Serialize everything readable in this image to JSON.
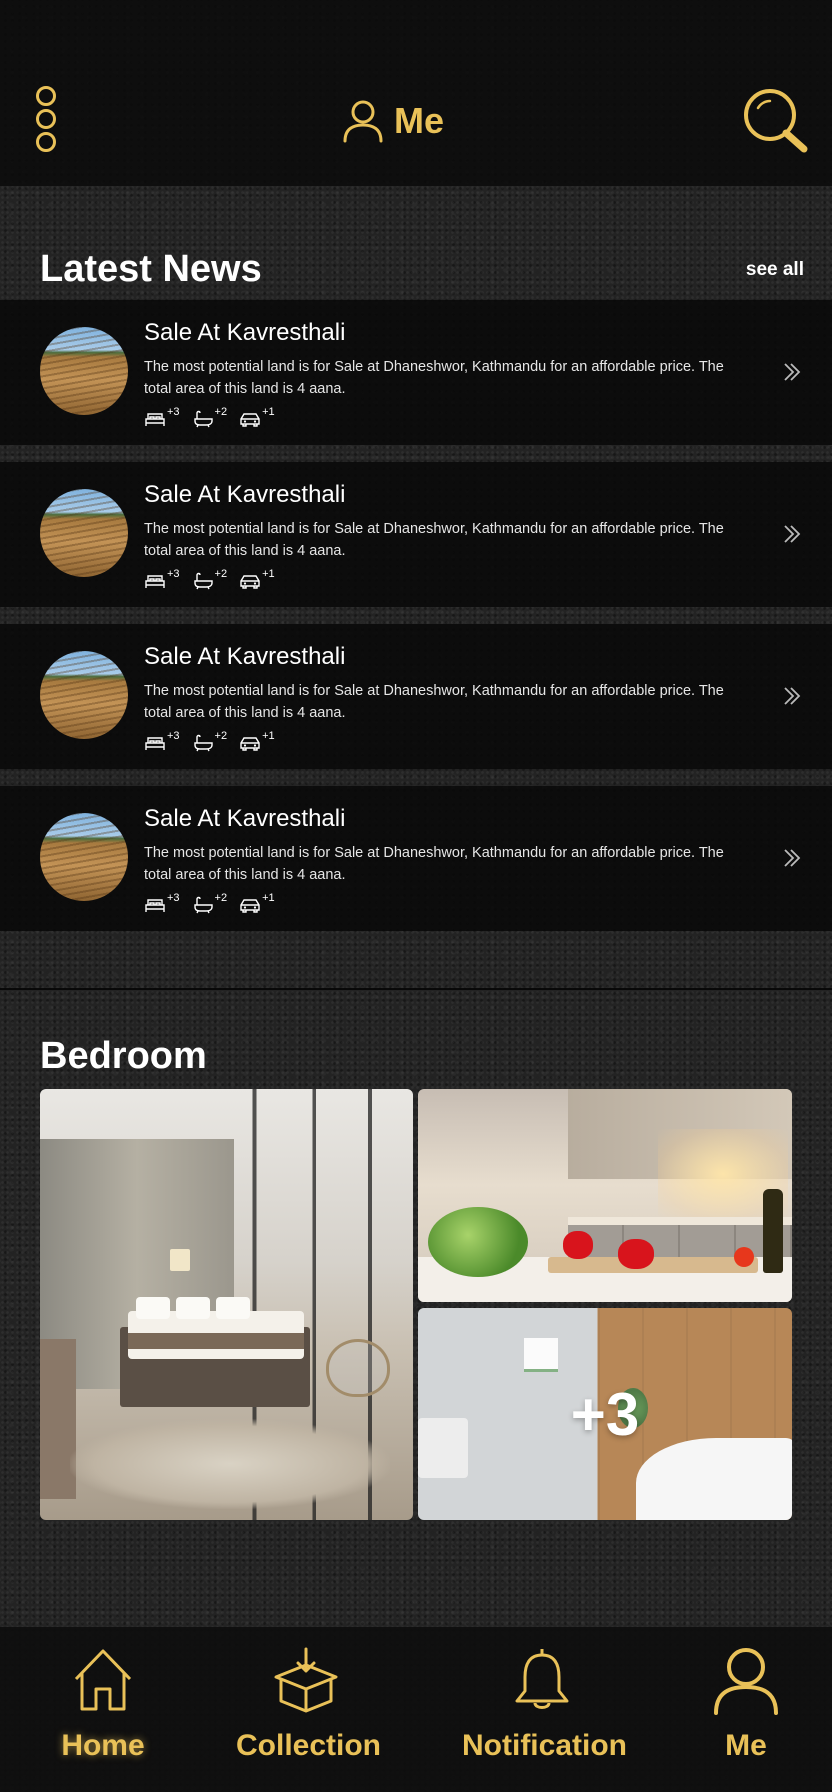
{
  "header": {
    "title": "Me",
    "menu_icon": "more-vertical-icon",
    "search_icon": "search-icon"
  },
  "latest_news": {
    "title": "Latest News",
    "see_all": "see all",
    "items": [
      {
        "title": "Sale At Kavresthali",
        "description": "The most potential land is for Sale at Dhaneshwor, Kathmandu for an affordable price. The total area of this land is 4 aana.",
        "beds": "+3",
        "baths": "+2",
        "cars": "+1"
      },
      {
        "title": "Sale At Kavresthali",
        "description": "The most potential land is for Sale at Dhaneshwor, Kathmandu for an affordable price. The total area of this land is 4 aana.",
        "beds": "+3",
        "baths": "+2",
        "cars": "+1"
      },
      {
        "title": "Sale At Kavresthali",
        "description": "The most potential land is for Sale at Dhaneshwor, Kathmandu for an affordable price. The total area of this land is 4 aana.",
        "beds": "+3",
        "baths": "+2",
        "cars": "+1"
      },
      {
        "title": "Sale At Kavresthali",
        "description": "The most potential land is for Sale at Dhaneshwor, Kathmandu for an affordable price. The total area of this land is 4 aana.",
        "beds": "+3",
        "baths": "+2",
        "cars": "+1"
      }
    ]
  },
  "gallery": {
    "title": "Bedroom",
    "more_count": "+3"
  },
  "bottom_nav": {
    "items": [
      {
        "label": "Home",
        "icon": "home-icon"
      },
      {
        "label": "Collection",
        "icon": "box-download-icon"
      },
      {
        "label": "Notification",
        "icon": "bell-icon"
      },
      {
        "label": "Me",
        "icon": "user-icon"
      }
    ]
  },
  "colors": {
    "accent": "#e9c158",
    "background": "#232323",
    "panel": "#0a0a0a",
    "text": "#ffffff"
  }
}
